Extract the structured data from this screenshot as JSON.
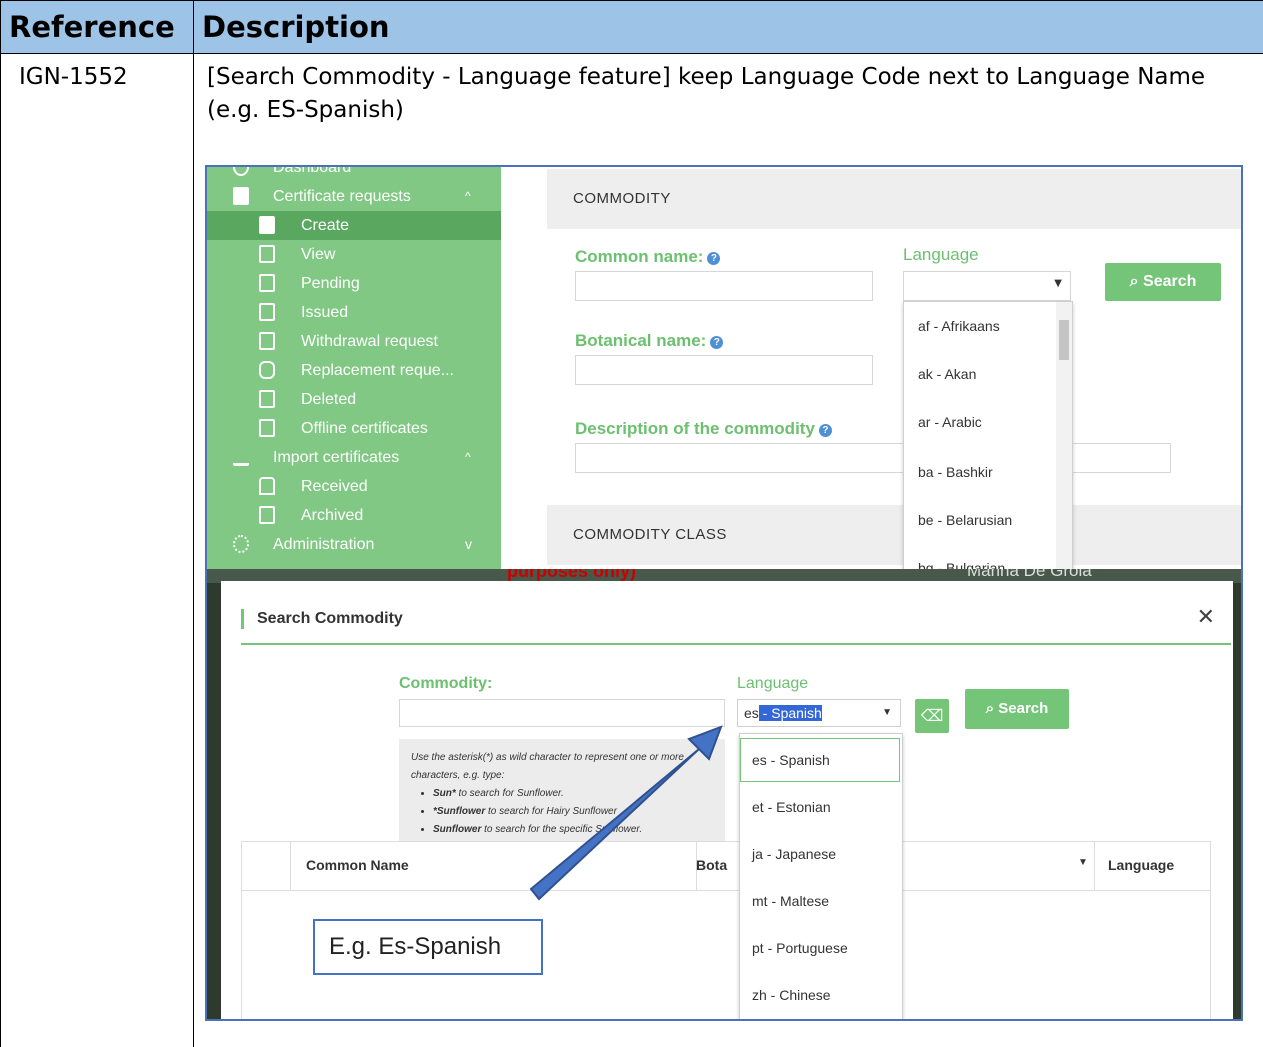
{
  "table": {
    "header_reference": "Reference",
    "header_description": "Description",
    "reference": "IGN-1552",
    "description": "[Search Commodity - Language feature] keep Language Code next to Language Name (e.g. ES-Spanish)"
  },
  "top_screenshot": {
    "sidebar": {
      "items": [
        {
          "label": "Dashboard"
        },
        {
          "label": "Certificate requests"
        },
        {
          "label": "Create"
        },
        {
          "label": "View"
        },
        {
          "label": "Pending"
        },
        {
          "label": "Issued"
        },
        {
          "label": "Withdrawal request"
        },
        {
          "label": "Replacement reque..."
        },
        {
          "label": "Deleted"
        },
        {
          "label": "Offline certificates"
        },
        {
          "label": "Import certificates"
        },
        {
          "label": "Received"
        },
        {
          "label": "Archived"
        },
        {
          "label": "Administration"
        }
      ]
    },
    "section_commodity": "COMMODITY",
    "section_commodity_class": "COMMODITY CLASS",
    "common_name_label": "Common name:",
    "botanical_name_label": "Botanical name:",
    "description_label": "Description of the commodity",
    "language_label": "Language",
    "search_button": "Search",
    "language_options": [
      "af - Afrikaans",
      "ak - Akan",
      "ar - Arabic",
      "ba - Bashkir",
      "be - Belarusian",
      "bg - Bulgarian"
    ]
  },
  "bottom_screenshot": {
    "strip_text_red": "purposes only)",
    "strip_text_right": "Marina De Groia",
    "modal_title": "Search Commodity",
    "commodity_label": "Commodity:",
    "language_label": "Language",
    "language_value_code": "es",
    "language_value_name": " - Spanish",
    "search_button": "Search",
    "hint_intro": "Use the asterisk(*) as wild character to represent one or more characters, e.g. type:",
    "hint_items": [
      {
        "bold": "Sun*",
        "text": " to search for Sunflower."
      },
      {
        "bold": "*Sunflower",
        "text": " to search for Hairy Sunflower"
      },
      {
        "bold": "Sunflower",
        "text": " to search for the specific Sunflower."
      }
    ],
    "grid_columns": {
      "common_name": "Common Name",
      "botanical": "Bota",
      "language": "Language"
    },
    "language_options": [
      "es - Spanish",
      "et - Estonian",
      "ja - Japanese",
      "mt - Maltese",
      "pt - Portuguese",
      "zh - Chinese"
    ],
    "callout": "E.g. Es-Spanish"
  }
}
